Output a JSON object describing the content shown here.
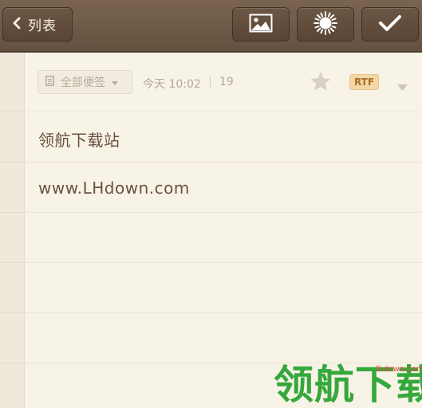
{
  "toolbar": {
    "back_label": "列表",
    "back_icon": "chevron-left-icon",
    "image_icon": "image-icon",
    "theme_icon": "brightness-icon",
    "done_icon": "checkmark-icon"
  },
  "meta": {
    "category": "全部便签",
    "category_icon": "note-icon",
    "timestamp": "今天 10:02",
    "char_count": "19",
    "star_icon": "star-icon",
    "format_badge": "RTF",
    "format_caret_icon": "chevron-down-icon"
  },
  "note": {
    "lines": [
      "领航下载站",
      "www.LHdown.com"
    ]
  },
  "watermark": {
    "text": "领航下载",
    "url": "lhdown.com"
  },
  "colors": {
    "toolbar": "#6e5948",
    "paper": "#f8f3e7",
    "text": "#6b5240",
    "rtf_badge": "#f3d7a6",
    "watermark_green": "#35a83b",
    "watermark_red": "#e84a3b"
  }
}
